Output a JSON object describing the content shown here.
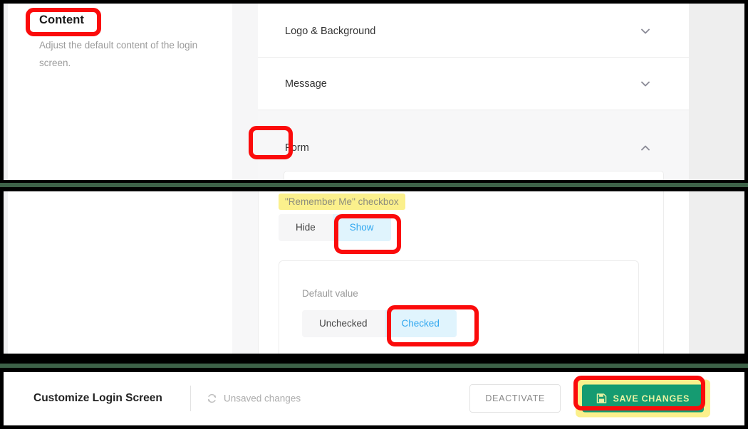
{
  "app": {
    "title": "Customize Login Screen"
  },
  "sidebar": {
    "section_title": "Content",
    "section_description": "Adjust the default content of the login screen."
  },
  "accordion": {
    "items": [
      {
        "label": "Logo & Background",
        "state": "collapsed",
        "icon": "chevron-down-icon"
      },
      {
        "label": "Message",
        "state": "collapsed",
        "icon": "chevron-down-icon"
      },
      {
        "label": "Form",
        "state": "expanded",
        "icon": "chevron-up-icon"
      }
    ]
  },
  "form_section": {
    "remember_me": {
      "label": "\"Remember Me\" checkbox",
      "options": [
        "Hide",
        "Show"
      ],
      "selected": "Show"
    },
    "default_value": {
      "label": "Default value",
      "options": [
        "Unchecked",
        "Checked"
      ],
      "selected": "Checked"
    }
  },
  "bottom_bar": {
    "title": "Customize Login Screen",
    "status_icon": "sync-icon",
    "status_text": "Unsaved changes",
    "deactivate_label": "DEACTIVATE",
    "save_icon": "save-floppy-icon",
    "save_label": "SAVE CHANGES"
  },
  "colors": {
    "accent_blue": "#30a7ef",
    "selected_chip_bg": "#e0f4fd",
    "highlight_yellow": "#fbf08c",
    "save_green": "#159b71",
    "save_text": "#e7f2a3",
    "annotation_red": "#fb0b0b",
    "separator_green": "#3d6248"
  }
}
